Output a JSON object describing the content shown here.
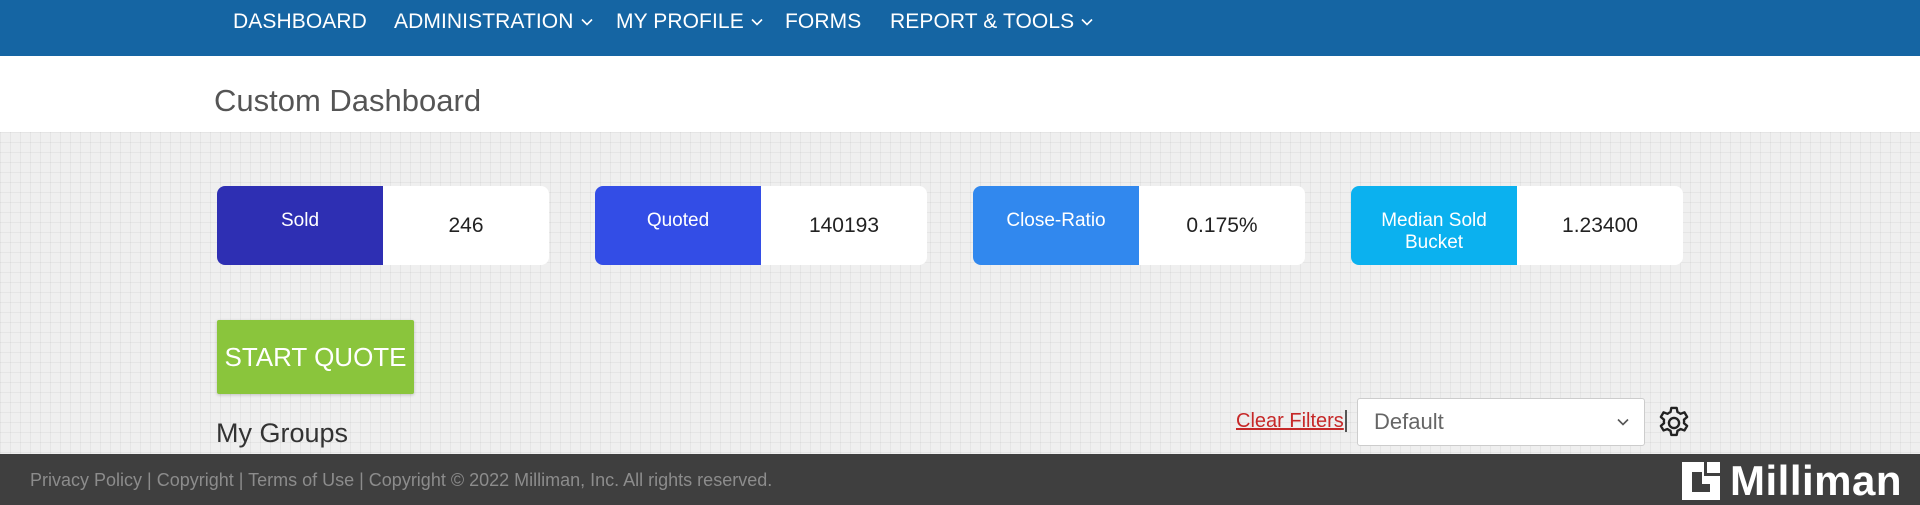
{
  "nav": {
    "dashboard": "DASHBOARD",
    "administration": "ADMINISTRATION",
    "my_profile": "MY PROFILE",
    "forms": "FORMS",
    "report_tools": "REPORT & TOOLS"
  },
  "page": {
    "title": "Custom Dashboard"
  },
  "stats": [
    {
      "label": "Sold",
      "value": "246",
      "color": "#2e2fb3"
    },
    {
      "label": "Quoted",
      "value": "140193",
      "color": "#334de6"
    },
    {
      "label": "Close-Ratio",
      "value": "0.175%",
      "color": "#3188ee"
    },
    {
      "label": "Median Sold Bucket",
      "value": "1.23400",
      "color": "#0bb1ef"
    }
  ],
  "actions": {
    "start_quote": "START QUOTE"
  },
  "groups": {
    "heading": "My Groups",
    "clear_filters": "Clear Filters",
    "view_select": "Default"
  },
  "footer": {
    "text": "Privacy Policy | Copyright | Terms of Use | Copyright © 2022 Milliman, Inc. All rights reserved.",
    "logo": "Milliman"
  },
  "colors": {
    "nav_bg": "#1565a3",
    "accent_green": "#8ac53c",
    "footer_bg": "#3f3f3f",
    "link_red": "#c62828"
  },
  "icons": [
    "chevron-down-icon",
    "gear-icon",
    "milliman-logo-icon"
  ]
}
